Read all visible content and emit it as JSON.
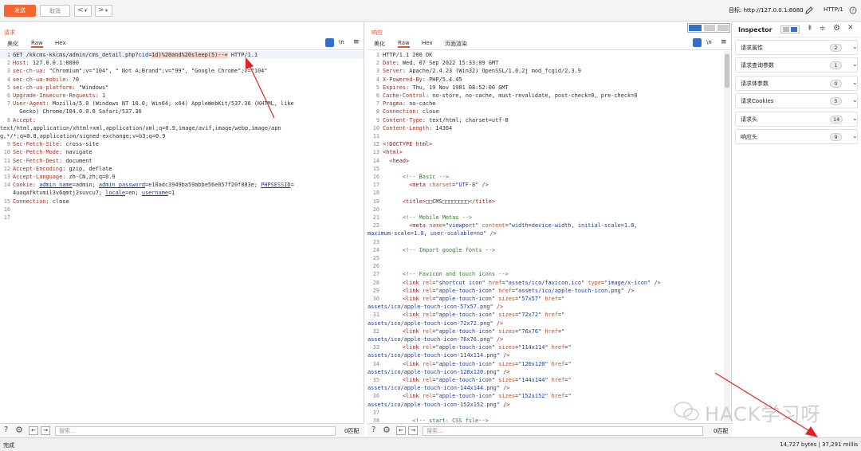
{
  "toolbar": {
    "send_label": "发送",
    "cancel_label": "取消",
    "back_label": "<",
    "forward_label": ">",
    "dropdown_label": "▾",
    "target_label": "目标: http://127.0.0.1:8080",
    "protocol_label": "HTTP/1"
  },
  "request": {
    "title": "请求",
    "tabs": [
      "美化",
      "Raw",
      "Hex"
    ],
    "active_tab": "Raw",
    "ln_label": "\\n"
  },
  "response": {
    "title": "响应",
    "tabs": [
      "美化",
      "Raw",
      "Hex",
      "页面渲染"
    ],
    "active_tab": "Raw",
    "ln_label": "\\n"
  },
  "inspector": {
    "title": "Inspector",
    "rows": [
      {
        "label": "请求属性",
        "count": "2"
      },
      {
        "label": "请求查询参数",
        "count": "1"
      },
      {
        "label": "请求体参数",
        "count": "0"
      },
      {
        "label": "请求Cookies",
        "count": "5"
      },
      {
        "label": "请求头",
        "count": "14"
      },
      {
        "label": "响应头",
        "count": "9"
      }
    ]
  },
  "bottom": {
    "search_placeholder": "搜索...",
    "match_count_left": "0匹配",
    "match_count_right": "0匹配"
  },
  "status": {
    "left_text": "完成",
    "right_text": "14,727 bytes | 37,291 millis"
  },
  "watermark": "HACK学习呀",
  "colors": {
    "accent": "#f2652f",
    "arrow": "#e02424"
  }
}
